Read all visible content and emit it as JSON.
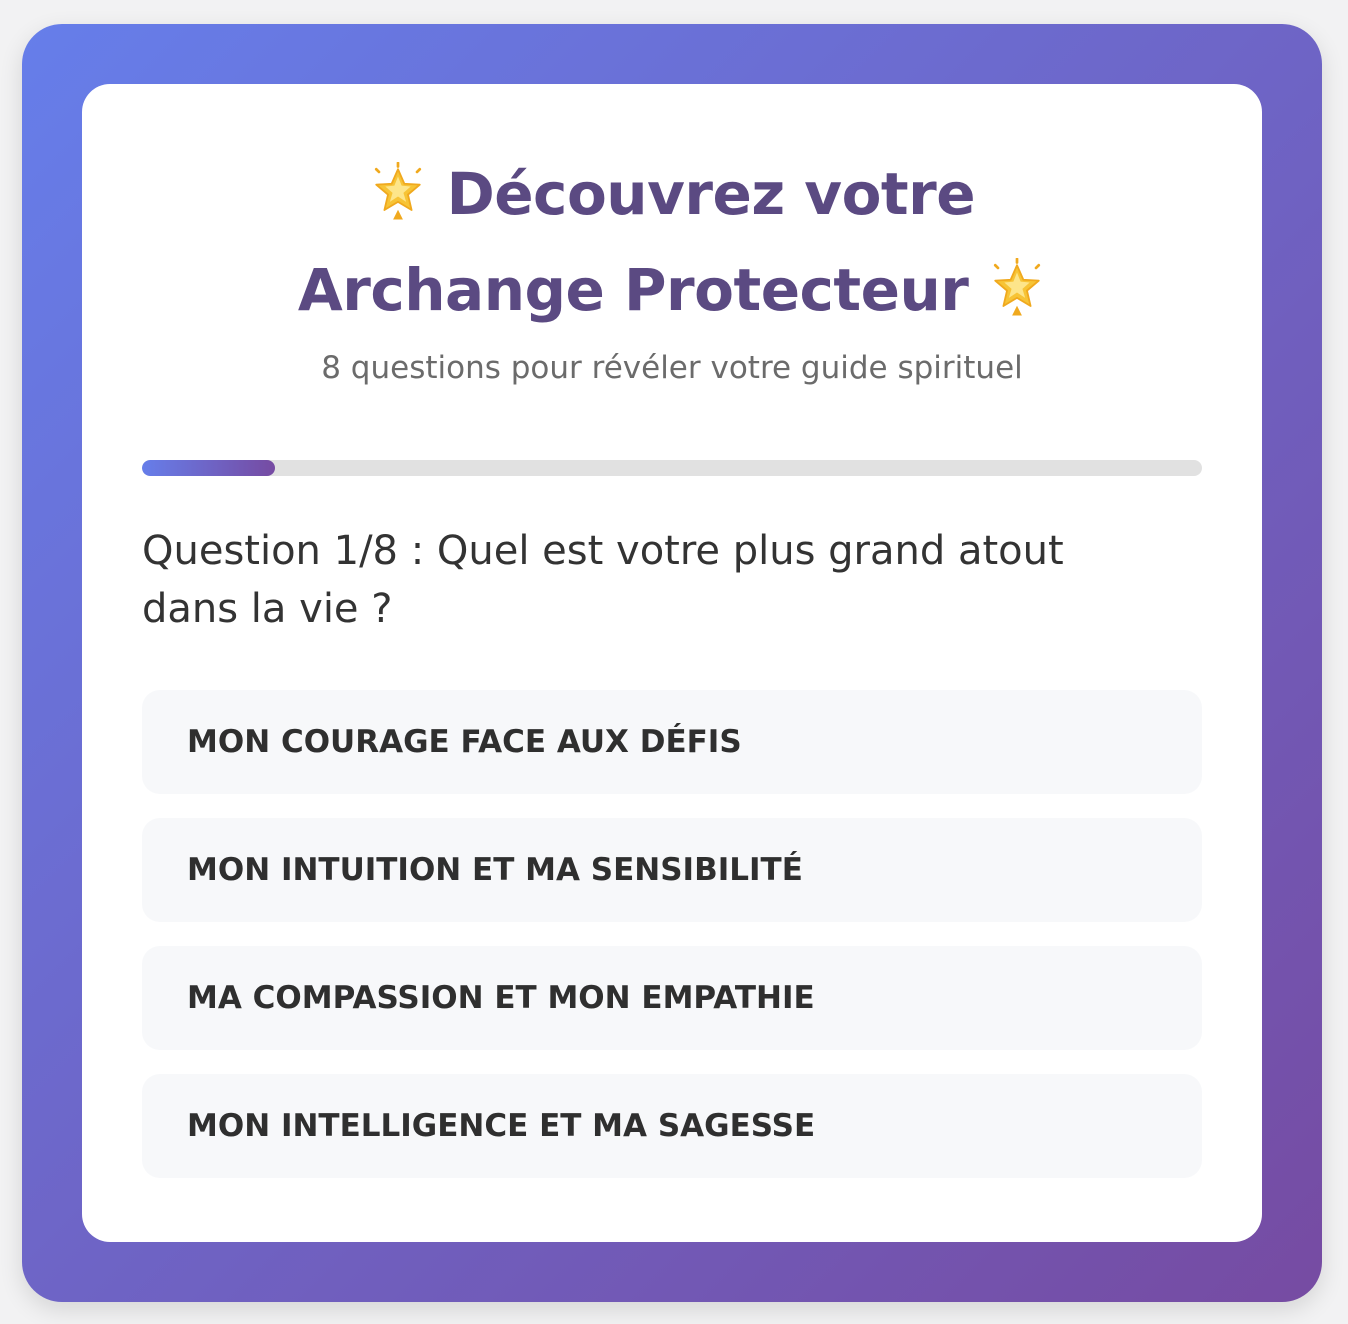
{
  "header": {
    "title_line1": "Découvrez votre",
    "title_line2": "Archange Protecteur",
    "star_icon": "glowing-star-icon",
    "subtitle": "8 questions pour révéler votre guide spirituel"
  },
  "progress": {
    "fraction": 0.125
  },
  "question": {
    "text": "Question 1/8 : Quel est votre plus grand atout dans la vie ?"
  },
  "options": [
    {
      "label": "MON COURAGE FACE AUX DÉFIS"
    },
    {
      "label": "MON INTUITION ET MA SENSIBILITÉ"
    },
    {
      "label": "MA COMPASSION ET MON EMPATHIE"
    },
    {
      "label": "MON INTELLIGENCE ET MA SAGESSE"
    }
  ],
  "colors": {
    "gradient_start": "#667eea",
    "gradient_end": "#764ba2",
    "title": "#5b4a82"
  }
}
